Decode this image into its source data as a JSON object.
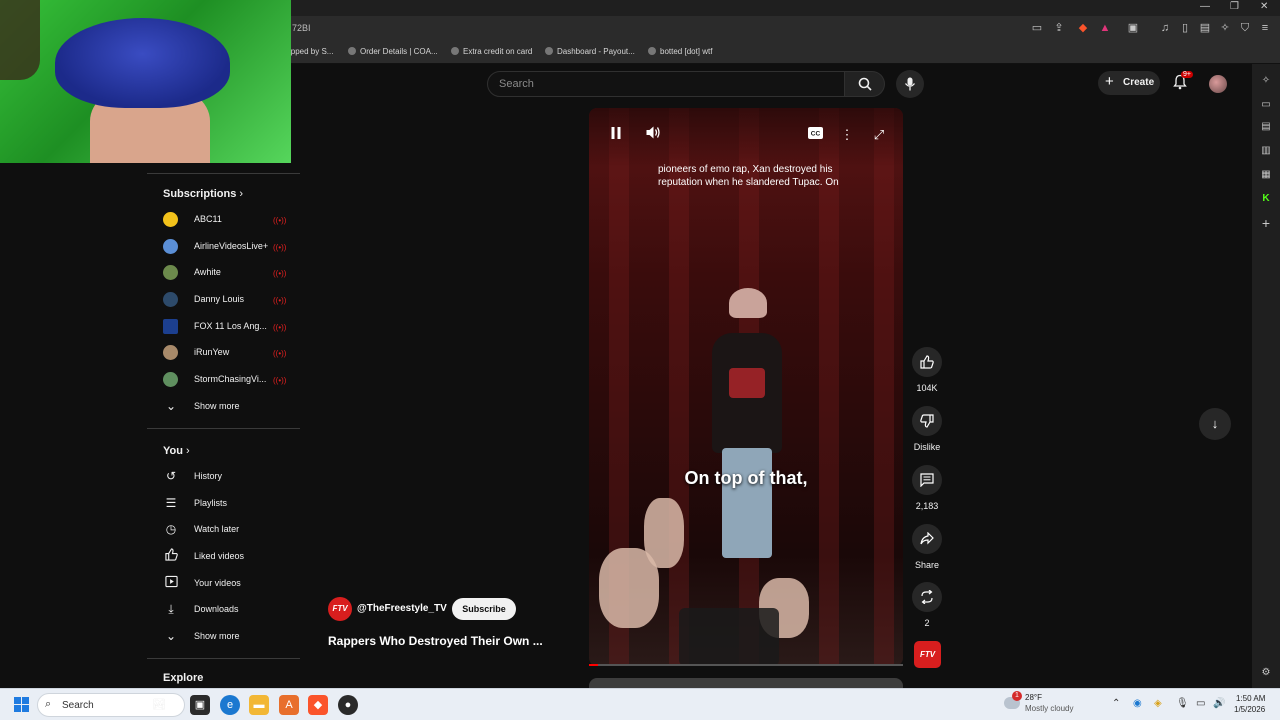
{
  "browser": {
    "url_fragment": "72BI",
    "bookmarks": [
      "ipped by S...",
      "Order Details | COA...",
      "Extra credit on card",
      "Dashboard - Payout...",
      "botted [dot] wtf"
    ]
  },
  "youtube": {
    "search_placeholder": "Search",
    "create_label": "Create",
    "notification_count": "9+",
    "sidebar": {
      "subscriptions_title": "Subscriptions",
      "subscriptions": [
        {
          "name": "ABC11",
          "color": "#f2c21b"
        },
        {
          "name": "AirlineVideosLive+",
          "color": "#5b8fd6"
        },
        {
          "name": "Awhite",
          "color": "#6c8a4c"
        },
        {
          "name": "Danny Louis",
          "color": "#2d4a6a"
        },
        {
          "name": "FOX 11 Los Ang...",
          "color": "#1c3f8f"
        },
        {
          "name": "iRunYew",
          "color": "#a88a6a"
        },
        {
          "name": "StormChasingVi...",
          "color": "#5f8f5f"
        }
      ],
      "show_more": "Show more",
      "you_title": "You",
      "you_items": [
        {
          "label": "History",
          "icon": "history-icon",
          "glyph": "↺"
        },
        {
          "label": "Playlists",
          "icon": "playlists-icon",
          "glyph": "☰"
        },
        {
          "label": "Watch later",
          "icon": "clock-icon",
          "glyph": "◷"
        },
        {
          "label": "Liked videos",
          "icon": "thumb-up-icon",
          "glyph": "👍"
        },
        {
          "label": "Your videos",
          "icon": "video-icon",
          "glyph": "▷"
        },
        {
          "label": "Downloads",
          "icon": "download-icon",
          "glyph": "⤓"
        }
      ],
      "show_more_2": "Show more",
      "explore_title": "Explore"
    },
    "short": {
      "caption_top": "pioneers of emo rap, Xan destroyed his reputation when he slandered Tupac. On",
      "caption_big": "On top of that,",
      "channel": "@TheFreestyle_TV",
      "channel_badge": "FTV",
      "subscribe": "Subscribe",
      "title": "Rappers Who Destroyed Their Own ...",
      "progress": 0.03
    },
    "actions": {
      "likes": "104K",
      "dislike": "Dislike",
      "comments": "2,183",
      "share": "Share",
      "remix": "2"
    }
  },
  "taskbar": {
    "search_placeholder": "Search",
    "weather_temp": "28°F",
    "weather_desc": "Mostly cloudy",
    "weather_badge": "1",
    "time": "1:50 AM",
    "date": "1/5/2026"
  },
  "colors": {
    "accent_red": "#ff0000",
    "live_red": "#e02020",
    "background": "#0f0f0f"
  }
}
